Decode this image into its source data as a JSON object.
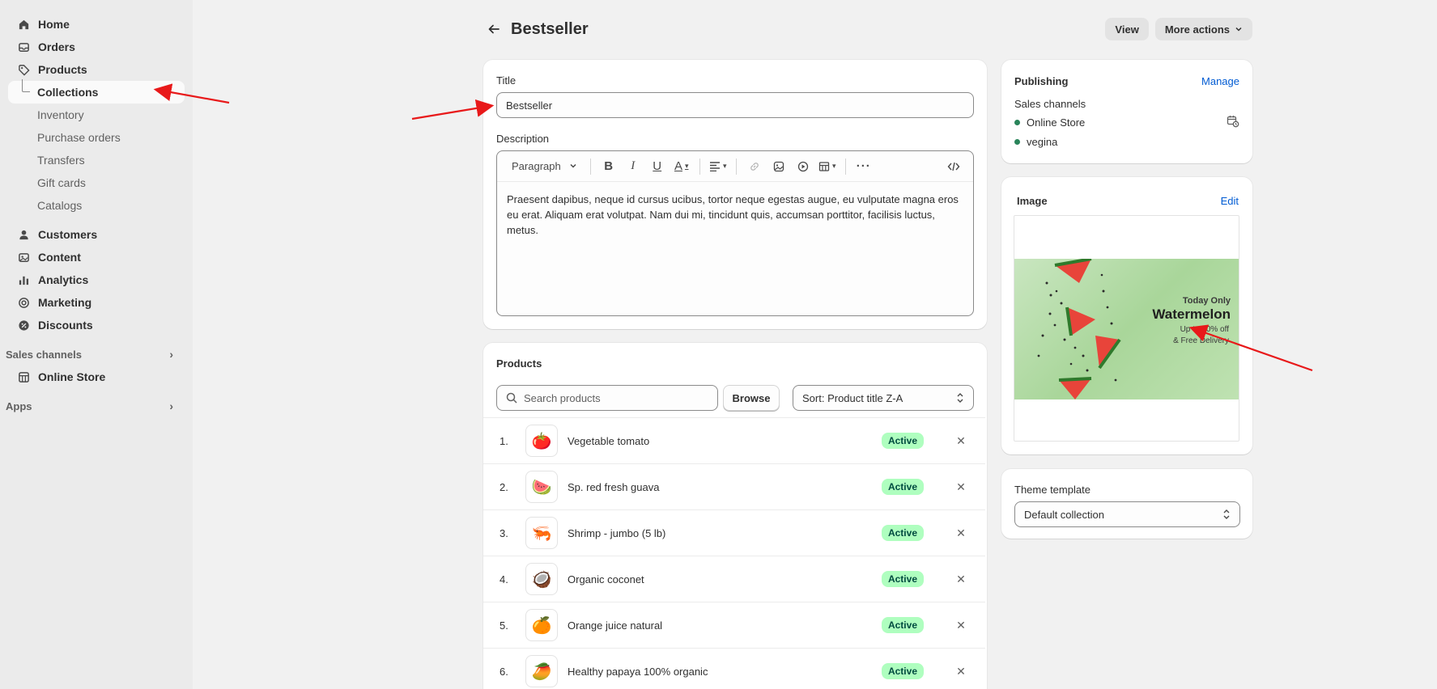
{
  "sidebar": {
    "nav": [
      {
        "label": "Home",
        "icon": "home-icon"
      },
      {
        "label": "Orders",
        "icon": "orders-icon"
      },
      {
        "label": "Products",
        "icon": "tag-icon"
      }
    ],
    "product_sub": [
      "Collections",
      "Inventory",
      "Purchase orders",
      "Transfers",
      "Gift cards",
      "Catalogs"
    ],
    "nav2": [
      {
        "label": "Customers",
        "icon": "person-icon"
      },
      {
        "label": "Content",
        "icon": "content-icon"
      },
      {
        "label": "Analytics",
        "icon": "bar-chart-icon"
      },
      {
        "label": "Marketing",
        "icon": "target-icon"
      },
      {
        "label": "Discounts",
        "icon": "discount-icon"
      }
    ],
    "sales_channels_label": "Sales channels",
    "online_store_label": "Online Store",
    "apps_label": "Apps"
  },
  "header": {
    "title": "Bestseller",
    "view_label": "View",
    "more_actions_label": "More actions"
  },
  "form": {
    "title_label": "Title",
    "title_value": "Bestseller",
    "description_label": "Description",
    "paragraph_label": "Paragraph",
    "description_text": "Praesent dapibus, neque id cursus ucibus, tortor neque egestas augue, eu vulputate magna eros eu erat. Aliquam erat volutpat. Nam dui mi, tincidunt quis, accumsan porttitor, facilisis luctus, metus."
  },
  "products": {
    "heading": "Products",
    "search_placeholder": "Search products",
    "browse_label": "Browse",
    "sort_label": "Sort: Product title Z-A",
    "items": [
      {
        "num": "1.",
        "name": "Vegetable tomato",
        "status": "Active",
        "thumb": "🍅"
      },
      {
        "num": "2.",
        "name": "Sp. red fresh guava",
        "status": "Active",
        "thumb": "🍉"
      },
      {
        "num": "3.",
        "name": "Shrimp - jumbo (5 lb)",
        "status": "Active",
        "thumb": "🦐"
      },
      {
        "num": "4.",
        "name": "Organic coconet",
        "status": "Active",
        "thumb": "🥥"
      },
      {
        "num": "5.",
        "name": "Orange juice natural",
        "status": "Active",
        "thumb": "🍊"
      },
      {
        "num": "6.",
        "name": "Healthy papaya 100% organic",
        "status": "Active",
        "thumb": "🥭"
      }
    ]
  },
  "publishing": {
    "heading": "Publishing",
    "manage_label": "Manage",
    "sales_channels_label": "Sales channels",
    "channels": [
      "Online Store",
      "vegina"
    ]
  },
  "image_card": {
    "heading": "Image",
    "edit_label": "Edit",
    "banner": {
      "line1": "Today Only",
      "line2": "Watermelon",
      "line3": "Up to 40% off",
      "line4": "& Free Delivery"
    }
  },
  "theme": {
    "label": "Theme template",
    "value": "Default collection"
  },
  "colors": {
    "accent_link": "#005bd3",
    "status_green": "#29845a",
    "badge_bg": "#affebf",
    "annotation_red": "#e8191a"
  }
}
